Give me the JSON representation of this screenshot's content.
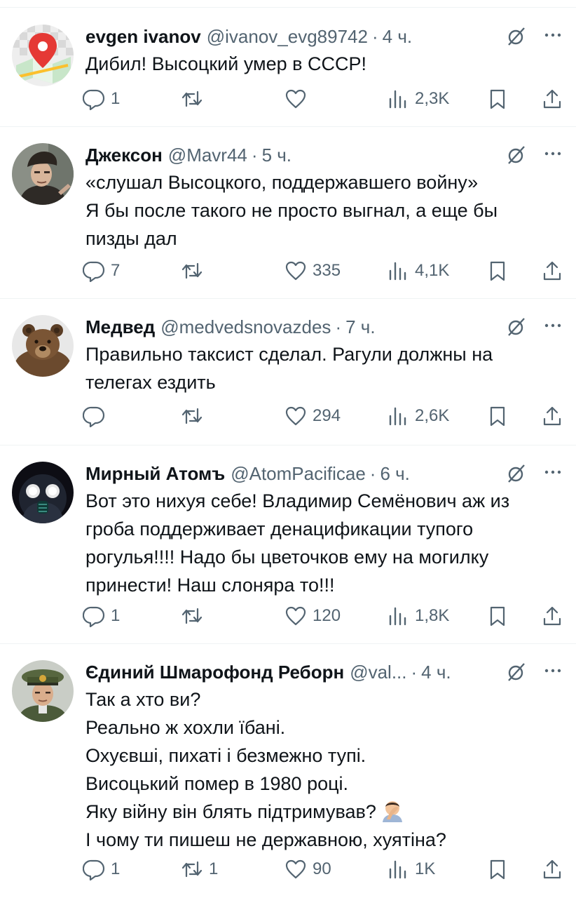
{
  "tweets": [
    {
      "avatar": "map-pin-avatar",
      "name": "evgen ivanov",
      "handle": "@ivanov_evg89742",
      "separator": "·",
      "time": "4 ч.",
      "lines": [
        "Дибил! Высоцкий умер в СССР!"
      ],
      "replies": "1",
      "retweets": "",
      "likes": "",
      "views": "2,3K"
    },
    {
      "avatar": "man-cap-avatar",
      "name": "Джексон",
      "handle": "@Mavr44",
      "separator": "·",
      "time": "5 ч.",
      "lines": [
        "«слушал Высоцкого, поддержавшего войну»",
        "Я бы после такого не просто выгнал, а еще бы",
        "пизды дал"
      ],
      "replies": "7",
      "retweets": "",
      "likes": "335",
      "views": "4,1K"
    },
    {
      "avatar": "bear-avatar",
      "name": "Медвед",
      "handle": "@medvedsnovazdes",
      "separator": "·",
      "time": "7 ч.",
      "lines": [
        "Правильно таксист сделал. Рагули должны на",
        "телегах ездить"
      ],
      "replies": "",
      "retweets": "",
      "likes": "294",
      "views": "2,6K"
    },
    {
      "avatar": "gasmask-avatar",
      "name": "Мирный Атомъ",
      "handle": "@AtomPacificae",
      "separator": "·",
      "time": "6 ч.",
      "lines": [
        "Вот это нихуя себе! Владимир Семёнович аж из",
        "гроба поддерживает денацификации тупого",
        "рогулья!!!! Надо бы цветочков ему на могилку",
        "принести! Наш слоняра то!!!"
      ],
      "replies": "1",
      "retweets": "",
      "likes": "120",
      "views": "1,8K"
    },
    {
      "avatar": "officer-avatar",
      "name": "Єдиний Шмарофонд Реборн",
      "handle": "@val...",
      "separator": "·",
      "time": "4 ч.",
      "lines": [
        "Так а хто ви?",
        "Реально ж хохли їбані.",
        "Охуєвші, пихаті і безмежно тупі.",
        "Висоцький помер в 1980 році.",
        "Яку війну він блять підтримував?",
        "І чому ти пишеш не державною, хуятіна?"
      ],
      "emoji_line": 4,
      "emoji": "facepalm-emoji",
      "replies": "1",
      "retweets": "1",
      "likes": "90",
      "views": "1K"
    }
  ],
  "colors": {
    "text": "#0f1419",
    "secondary": "#536471",
    "divider": "#eff3f4"
  }
}
